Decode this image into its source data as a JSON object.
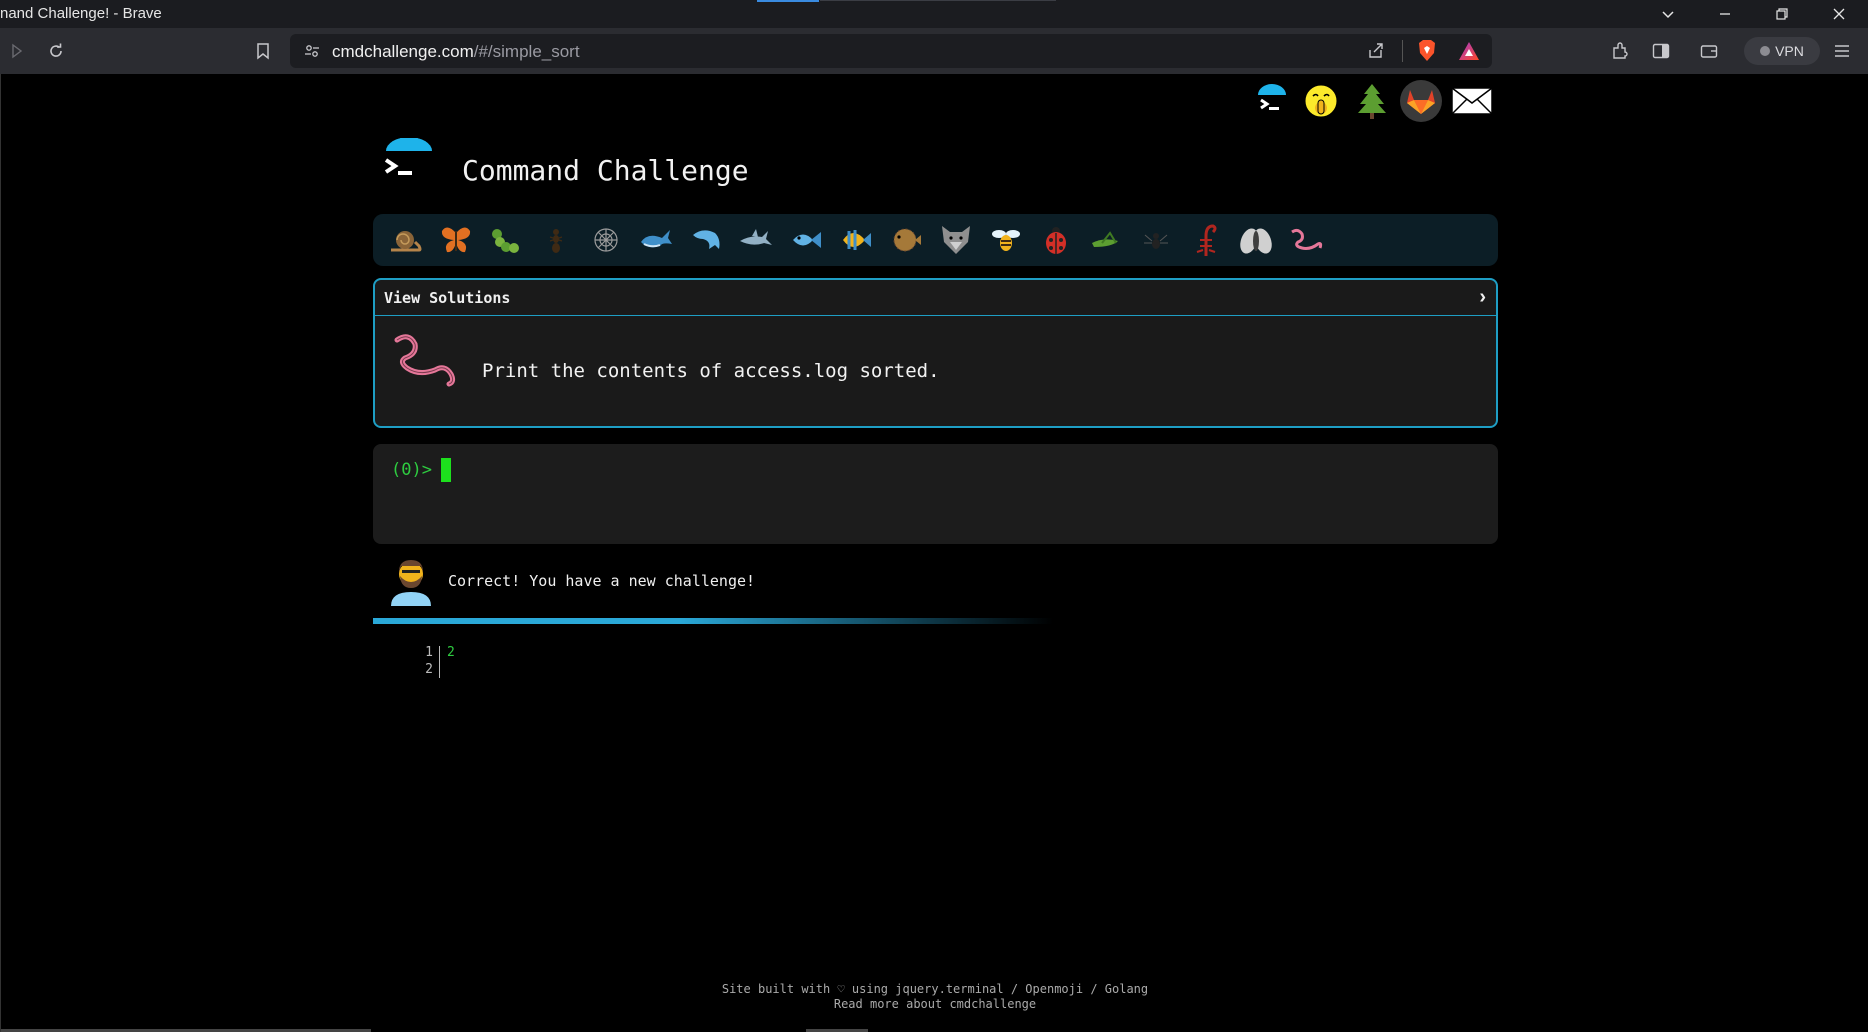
{
  "window": {
    "title": "nand Challenge! - Brave"
  },
  "browser": {
    "url_host": "cmdchallenge.com",
    "url_path": "/#/simple_sort",
    "vpn_label": "VPN"
  },
  "site": {
    "title": "Command Challenge"
  },
  "challenges": [
    "snail",
    "butterfly",
    "caterpillar",
    "ant",
    "spider-web",
    "whale",
    "dolphin",
    "shark",
    "fish",
    "tropical-fish",
    "blowfish",
    "wolf",
    "bee",
    "ladybug",
    "grasshopper",
    "spider",
    "scorpion",
    "fly",
    "worm"
  ],
  "panel": {
    "header": "View Solutions",
    "chevron": "›",
    "task": "Print the contents of access.log sorted."
  },
  "terminal": {
    "prompt": "(0)>"
  },
  "feedback": {
    "message": "Correct! You have a new challenge!"
  },
  "output": {
    "line_numbers": [
      "1",
      "2"
    ],
    "lines": [
      "2",
      ""
    ]
  },
  "footer": {
    "line1": "Site built with ♡ using jquery.terminal / Openmoji / Golang",
    "line2": "Read more about cmdchallenge"
  },
  "colors": {
    "accent": "#1e9ec4",
    "prompt": "#2ecc40",
    "cursor": "#1de01d"
  }
}
